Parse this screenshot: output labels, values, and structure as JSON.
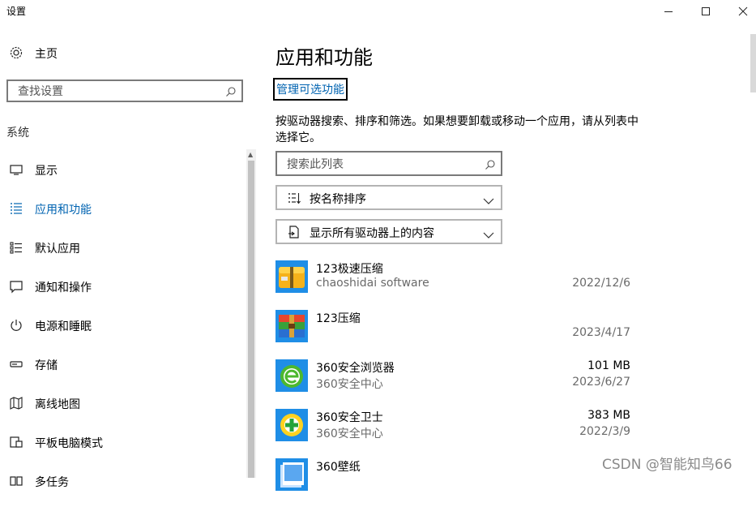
{
  "window": {
    "title": "设置",
    "minimize_icon": "minimize-icon",
    "maximize_icon": "maximize-icon",
    "close_icon": "close-icon"
  },
  "sidebar": {
    "home": {
      "label": "主页",
      "icon": "gear-icon"
    },
    "search": {
      "placeholder": "查找设置",
      "icon": "search-icon"
    },
    "section": "系统",
    "items": [
      {
        "label": "显示",
        "icon": "monitor-icon",
        "active": false
      },
      {
        "label": "应用和功能",
        "icon": "app-list-icon",
        "active": true
      },
      {
        "label": "默认应用",
        "icon": "default-apps-icon",
        "active": false
      },
      {
        "label": "通知和操作",
        "icon": "notification-icon",
        "active": false
      },
      {
        "label": "电源和睡眠",
        "icon": "power-icon",
        "active": false
      },
      {
        "label": "存储",
        "icon": "storage-icon",
        "active": false
      },
      {
        "label": "离线地图",
        "icon": "map-icon",
        "active": false
      },
      {
        "label": "平板电脑模式",
        "icon": "tablet-mode-icon",
        "active": false
      },
      {
        "label": "多任务",
        "icon": "multitask-icon",
        "active": false
      }
    ]
  },
  "main": {
    "title": "应用和功能",
    "manage_link": "管理可选功能",
    "description": "按驱动器搜索、排序和筛选。如果想要卸载或移动一个应用，请从列表中选择它。",
    "search": {
      "placeholder": "搜索此列表",
      "icon": "search-icon"
    },
    "sort": {
      "label": "按名称排序",
      "icon": "sort-icon"
    },
    "filter": {
      "label": "显示所有驱动器上的内容",
      "icon": "drive-icon"
    },
    "apps": [
      {
        "name": "123极速压缩",
        "publisher": "chaoshidai software",
        "size": "",
        "date": "2022/12/6",
        "icon": "zip-icon"
      },
      {
        "name": "123压缩",
        "publisher": "",
        "size": "",
        "date": "2023/4/17",
        "icon": "archive-icon"
      },
      {
        "name": "360安全浏览器",
        "publisher": "360安全中心",
        "size": "101 MB",
        "date": "2023/6/27",
        "icon": "browser-360-icon"
      },
      {
        "name": "360安全卫士",
        "publisher": "360安全中心",
        "size": "383 MB",
        "date": "2022/3/9",
        "icon": "guard-360-icon"
      },
      {
        "name": "360壁纸",
        "publisher": "",
        "size": "",
        "date": "",
        "icon": "wallpaper-360-icon"
      }
    ]
  },
  "watermark": "CSDN @智能知鸟66"
}
